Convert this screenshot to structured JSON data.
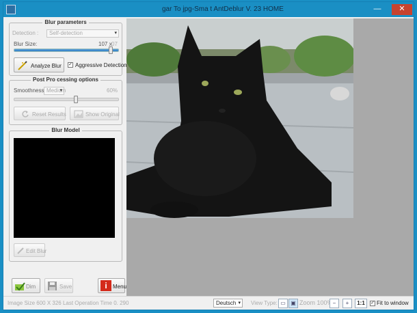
{
  "window": {
    "title": "gar To jpg-Sma t AntDeblur V. 23 HOME",
    "min_glyph": "—",
    "max_glyph": "❐",
    "close_glyph": "✕"
  },
  "blur_params": {
    "title": "Blur parameters",
    "detection_label": "Detection :",
    "detection_value": "Self-detection",
    "blur_size_label": "Blur Size:",
    "blur_size_value": "107 x",
    "blur_size_suffix": "07",
    "blur_size_fraction": 0.93,
    "analyze_label": "Analyze Blur",
    "aggressive_label": "Aggressive Detection",
    "aggressive_checked": true
  },
  "post_processing": {
    "title": "Post Pro cessing options",
    "smoothness_label": "Smoothness:",
    "smoothness_value": "Medium",
    "smoothness_percent": "60%",
    "smoothness_fraction": 0.6,
    "reset_label": "Reset Results",
    "show_original_label": "Show Original"
  },
  "blur_model": {
    "title": "Blur Model",
    "edit_label": "Edit Blur"
  },
  "bottom_buttons": {
    "open_label": "Dim",
    "save_label": "Save",
    "menu_label": "Menu"
  },
  "status": {
    "info": "Image Size 600 X 326 Last Operation Time 0. 290",
    "language": "Deutsch",
    "view_type_label": "View Type:",
    "zoom_label": "Zoom 100%",
    "one_to_one": "1:1",
    "fit_label": "Fit to window",
    "fit_checked": true
  },
  "icons": {
    "analyze": "wand-icon",
    "reset": "reset-icon",
    "show_original": "image-icon",
    "edit": "pencil-icon",
    "open": "folder-check-icon",
    "save": "floppy-icon",
    "menu": "info-icon",
    "zoom_in": "zoom-in-icon",
    "zoom_out": "zoom-out-icon"
  },
  "colors": {
    "accent": "#1a8fc4",
    "close": "#c7432f",
    "menu_icon": "#d42a1a"
  }
}
